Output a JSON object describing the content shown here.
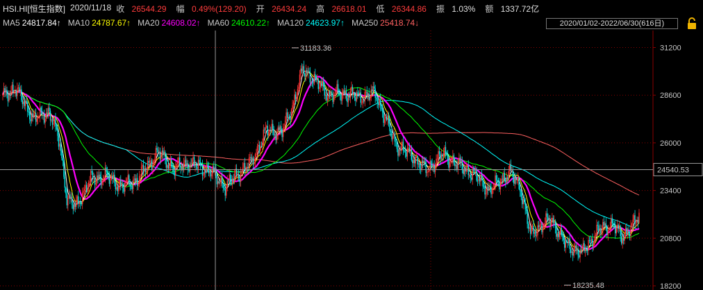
{
  "header": {
    "symbol": "HSI.HI[恒生指数]",
    "date": "2020/11/18",
    "close_label": "收",
    "close": "26544.29",
    "change_label": "幅",
    "change_pct": "0.49%(129.20)",
    "open_label": "开",
    "open": "26434.24",
    "high_label": "高",
    "high": "26618.01",
    "low_label": "低",
    "low": "26344.86",
    "amp_label": "振",
    "amplitude": "1.03%",
    "amount_label": "额",
    "amount": "1337.72亿"
  },
  "ma": [
    {
      "label": "MA5",
      "value": "24817.84↑",
      "color": "#ffffff"
    },
    {
      "label": "MA10",
      "value": "24787.67↑",
      "color": "#ffff00"
    },
    {
      "label": "MA20",
      "value": "24608.02↑",
      "color": "#ff00ff"
    },
    {
      "label": "MA60",
      "value": "24610.22↑",
      "color": "#00ff00"
    },
    {
      "label": "MA120",
      "value": "24623.97↑",
      "color": "#00ffff"
    },
    {
      "label": "MA250",
      "value": "25418.74↓",
      "color": "#ff6060"
    }
  ],
  "range_label": "2020/01/02-2022/06/30(616日)",
  "colors": {
    "up": "#ff3232",
    "down": "#00e5e5",
    "up_label": "#ff3c3c",
    "down_label": "#00d000",
    "ma5": "#ffffff",
    "ma10": "#ffff00",
    "ma20": "#ff00ff",
    "ma60": "#00ff00",
    "ma120": "#00ffff",
    "ma250": "#ff6060",
    "grid": "#8b0000"
  },
  "chart_data": {
    "type": "candlestick",
    "xlim": [
      "2020/01/02",
      "2022/06/30"
    ],
    "trading_days": 616,
    "y_ticks": [
      31200,
      28600,
      26000,
      23400,
      20800,
      18200
    ],
    "ylim": [
      18200,
      31900
    ],
    "crosshair_value": "24540.53",
    "crosshair_date": "2020/11/18",
    "max_label": "31183.36",
    "min_label": "18235.48",
    "close_path": [
      [
        0,
        28500
      ],
      [
        12,
        29000
      ],
      [
        30,
        27300
      ],
      [
        45,
        27700
      ],
      [
        55,
        26000
      ],
      [
        62,
        23000
      ],
      [
        70,
        22500
      ],
      [
        85,
        24000
      ],
      [
        100,
        24200
      ],
      [
        115,
        23600
      ],
      [
        130,
        24000
      ],
      [
        150,
        25500
      ],
      [
        165,
        24600
      ],
      [
        180,
        24900
      ],
      [
        200,
        24500
      ],
      [
        215,
        23600
      ],
      [
        225,
        24200
      ],
      [
        240,
        24900
      ],
      [
        255,
        26700
      ],
      [
        270,
        26600
      ],
      [
        280,
        28000
      ],
      [
        290,
        30000
      ],
      [
        300,
        29500
      ],
      [
        315,
        28600
      ],
      [
        330,
        28700
      ],
      [
        345,
        28500
      ],
      [
        360,
        28700
      ],
      [
        372,
        27000
      ],
      [
        380,
        25900
      ],
      [
        395,
        25300
      ],
      [
        410,
        24500
      ],
      [
        425,
        25400
      ],
      [
        440,
        24800
      ],
      [
        455,
        24300
      ],
      [
        470,
        23400
      ],
      [
        490,
        24400
      ],
      [
        500,
        23600
      ],
      [
        510,
        21000
      ],
      [
        520,
        21500
      ],
      [
        530,
        21800
      ],
      [
        545,
        20400
      ],
      [
        560,
        20000
      ],
      [
        575,
        21200
      ],
      [
        590,
        21600
      ],
      [
        598,
        20800
      ],
      [
        605,
        21300
      ],
      [
        615,
        21900
      ]
    ]
  }
}
